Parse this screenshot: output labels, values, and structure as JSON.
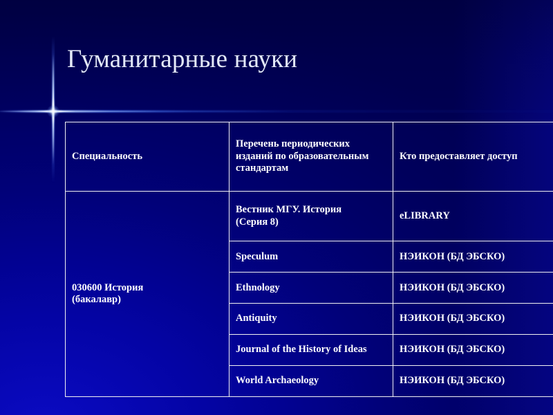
{
  "slide": {
    "title": "Гуманитарные науки",
    "background_color": "#000066",
    "accent_color": "#0000a8",
    "title_color": "#e3e9f7",
    "table_border_color": "#ffffff"
  },
  "decoration": {
    "sparkle_icon": "four-point-star-sparkle"
  },
  "table": {
    "headers": [
      "Специальность",
      "Перечень периодических изданий по образовательным стандартам",
      "Кто предоставляет доступ"
    ],
    "specialty_cell": "030600 История\n(бакалавр)",
    "rows": [
      {
        "journal": "Вестник МГУ. История\n(Серия 8)",
        "provider": "eLIBRARY"
      },
      {
        "journal": "Speculum",
        "provider": "НЭИКОН (БД ЭБСКО)"
      },
      {
        "journal": "Ethnology",
        "provider": "НЭИКОН (БД ЭБСКО)"
      },
      {
        "journal": "Antiquity",
        "provider": "НЭИКОН (БД ЭБСКО)"
      },
      {
        "journal": "Journal of the History of Ideas",
        "provider": "НЭИКОН (БД ЭБСКО)"
      },
      {
        "journal": "World Archaeology",
        "provider": "НЭИКОН (БД ЭБСКО)"
      }
    ]
  }
}
